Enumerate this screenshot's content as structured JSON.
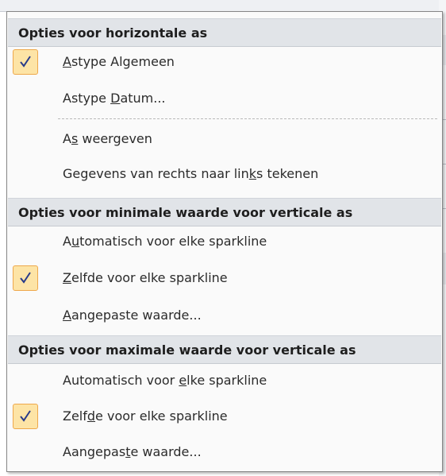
{
  "icons": {
    "checkmark": "checkmark-icon"
  },
  "colors": {
    "check_bg": "#fde4a6",
    "check_border": "#eea84b",
    "header_bg": "#e1e4e8"
  },
  "sections": [
    {
      "header": "Opties voor horizontale as",
      "items": [
        {
          "pre": "",
          "key": "A",
          "post": "stype Algemeen",
          "checked": true
        },
        {
          "pre": "Astype ",
          "key": "D",
          "post": "atum...",
          "checked": false
        },
        {
          "pre": "A",
          "key": "s",
          "post": " weergeven",
          "checked": false
        },
        {
          "pre": "Gegevens van rechts naar lin",
          "key": "k",
          "post": "s tekenen",
          "checked": false
        }
      ]
    },
    {
      "header": "Opties voor minimale waarde voor verticale as",
      "items": [
        {
          "pre": "A",
          "key": "u",
          "post": "tomatisch voor elke sparkline",
          "checked": false
        },
        {
          "pre": "",
          "key": "Z",
          "post": "elfde voor elke sparkline",
          "checked": true
        },
        {
          "pre": "",
          "key": "A",
          "post": "angepaste waarde...",
          "checked": false
        }
      ]
    },
    {
      "header": "Opties voor maximale waarde voor verticale as",
      "items": [
        {
          "pre": "Automatisch voor ",
          "key": "e",
          "post": "lke sparkline",
          "checked": false
        },
        {
          "pre": "Zelf",
          "key": "d",
          "post": "e voor elke sparkline",
          "checked": true
        },
        {
          "pre": "Aangepas",
          "key": "t",
          "post": "e waarde...",
          "checked": false
        }
      ]
    }
  ]
}
